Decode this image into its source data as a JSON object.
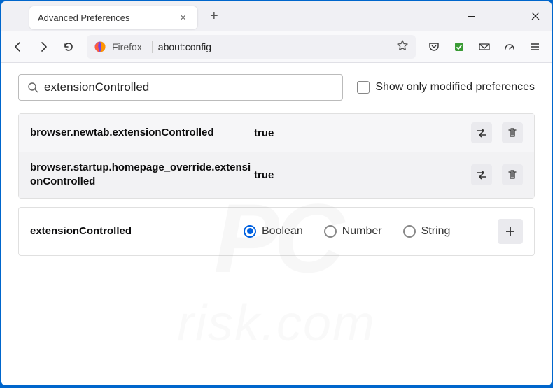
{
  "window": {
    "tab_title": "Advanced Preferences"
  },
  "urlbar": {
    "app_label": "Firefox",
    "url": "about:config"
  },
  "search": {
    "value": "extensionControlled",
    "checkbox_label": "Show only modified preferences"
  },
  "prefs": [
    {
      "name": "browser.newtab.extensionControlled",
      "value": "true"
    },
    {
      "name": "browser.startup.homepage_override.extensionControlled",
      "value": "true"
    }
  ],
  "newpref": {
    "name": "extensionControlled",
    "types": {
      "boolean": "Boolean",
      "number": "Number",
      "string": "String"
    }
  },
  "watermark": {
    "pc": "PC",
    "txt": "risk.com"
  }
}
